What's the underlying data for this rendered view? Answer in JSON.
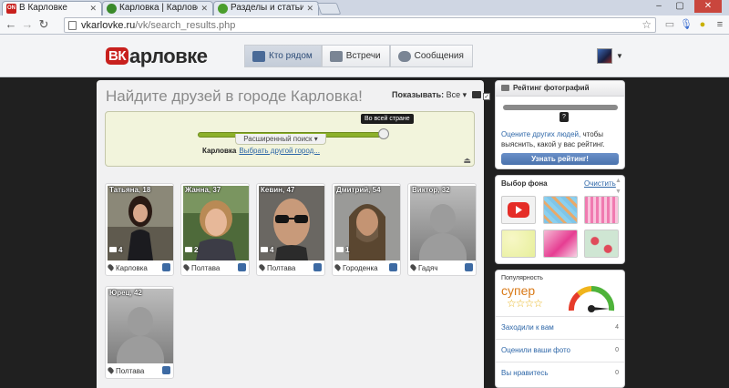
{
  "browser": {
    "tabs": [
      {
        "title": "В Карловке",
        "favicon": "ON",
        "fav_color": "#c8201d"
      },
      {
        "title": "Карловка | Карловский",
        "favicon": "",
        "fav_color": "#3a8a2a"
      },
      {
        "title": "Разделы и статьи - Пане",
        "favicon": "",
        "fav_color": "#4b9e2c"
      }
    ],
    "url_host": "vkarlovke.ru",
    "url_path": "/vk/search_results.php"
  },
  "site": {
    "logo_badge": "ВК",
    "logo_text": "арловке",
    "nav": [
      {
        "label": "Кто рядом",
        "active": true
      },
      {
        "label": "Встречи",
        "active": false
      },
      {
        "label": "Сообщения",
        "active": false
      }
    ]
  },
  "main": {
    "title": "Найдите друзей в городе Карловка!",
    "show_label": "Показывать:",
    "show_value": "Все",
    "slider_tooltip": "Во всей стране",
    "city": "Карловка",
    "change_city": "Выбрать другой город...",
    "advanced_search": "Расширенный поиск"
  },
  "people": [
    {
      "name": "Татьяна, 18",
      "photos": "4",
      "city": "Карловка",
      "has_photo": true
    },
    {
      "name": "Жанна, 37",
      "photos": "2",
      "city": "Полтава",
      "has_photo": true
    },
    {
      "name": "Кевин, 47",
      "photos": "4",
      "city": "Полтава",
      "has_photo": true
    },
    {
      "name": "Дмитрий, 54",
      "photos": "1",
      "city": "Городенка",
      "has_photo": true
    },
    {
      "name": "Виктор, 32",
      "photos": "",
      "city": "Гадяч",
      "has_photo": false
    },
    {
      "name": "Юрец, 42",
      "photos": "",
      "city": "Полтава",
      "has_photo": false
    }
  ],
  "sidebar": {
    "rating": {
      "title": "Рейтинг фотографий",
      "question": "?",
      "link": "Оцените других людей,",
      "text": " чтобы выяснить, какой у вас рейтинг.",
      "button": "Узнать рейтинг!"
    },
    "backgrounds": {
      "title": "Выбор фона",
      "clear": "Очистить"
    },
    "popularity": {
      "title": "Популярность",
      "level": "супер",
      "stats": [
        {
          "label": "Заходили к вам",
          "value": "4"
        },
        {
          "label": "Оценили ваши фото",
          "value": "0"
        },
        {
          "label": "Вы нравитесь",
          "value": "0"
        }
      ]
    }
  },
  "colors": {
    "brand_red": "#c8201d",
    "link_blue": "#2e67a8",
    "slider_green": "#8cb02a",
    "popularity_orange": "#d97a18"
  }
}
